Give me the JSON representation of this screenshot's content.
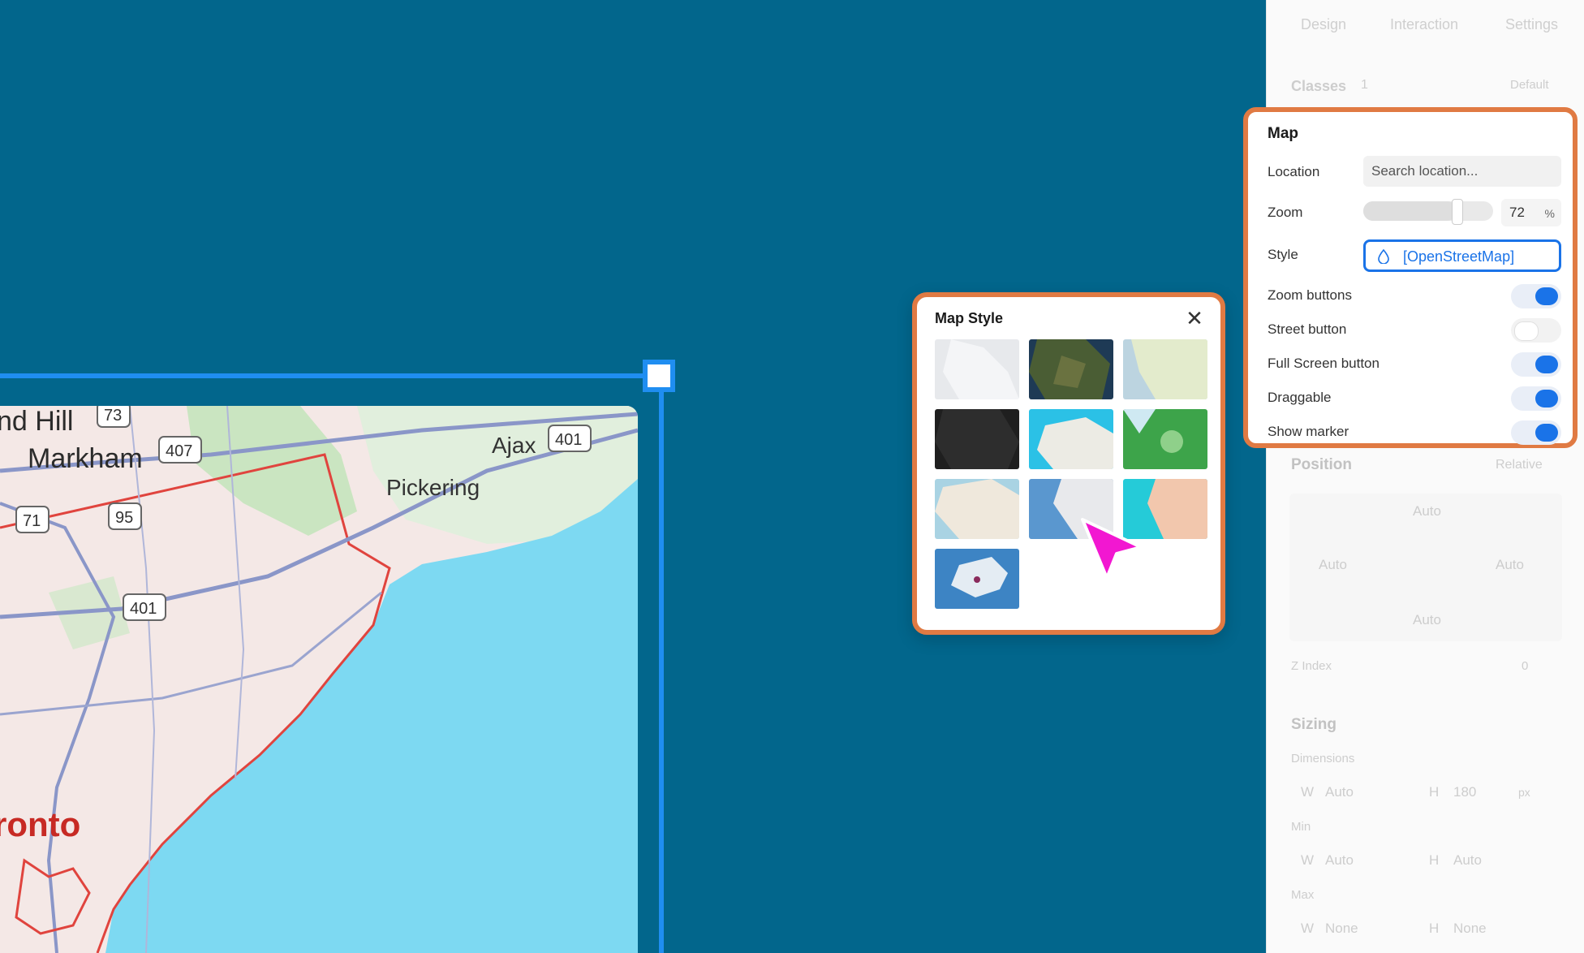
{
  "panel": {
    "tabs": [
      "Design",
      "Interaction",
      "Settings"
    ],
    "classes_label": "Classes",
    "classes_count": "1",
    "classes_default": "Default",
    "map_section": {
      "title": "Map",
      "location_label": "Location",
      "location_placeholder": "Search location...",
      "zoom_label": "Zoom",
      "zoom_value": "72",
      "zoom_percent": 72,
      "zoom_unit": "%",
      "style_label": "Style",
      "style_value": "[OpenStreetMap]",
      "toggles": [
        {
          "label": "Zoom buttons",
          "on": true
        },
        {
          "label": "Street button",
          "on": false
        },
        {
          "label": "Full Screen button",
          "on": true
        },
        {
          "label": "Draggable",
          "on": true
        },
        {
          "label": "Show marker",
          "on": true
        }
      ]
    },
    "position": {
      "title": "Position",
      "mode": "Relative",
      "top": "Auto",
      "left": "Auto",
      "right": "Auto",
      "bottom": "Auto",
      "zindex_label": "Z Index",
      "zindex_value": "0"
    },
    "sizing": {
      "title": "Sizing",
      "dimensions_label": "Dimensions",
      "w_prefix": "W",
      "h_prefix": "H",
      "w_value": "Auto",
      "h_value": "180",
      "h_unit": "px",
      "min_label": "Min",
      "min_w": "Auto",
      "min_h": "Auto",
      "max_label": "Max",
      "max_w": "None",
      "max_h": "None"
    }
  },
  "popover": {
    "title": "Map Style",
    "close": "✕",
    "tiles": [
      "light-gray",
      "satellite",
      "pastel",
      "dark",
      "cyan-relief",
      "green-terrain",
      "muted-road",
      "blue-water",
      "peach-water",
      "world-blue"
    ]
  },
  "map": {
    "labels": [
      "nd Hill",
      "Markham",
      "Pickering",
      "Ajax",
      "ronto"
    ],
    "shields": [
      "73",
      "407",
      "401",
      "71",
      "95",
      "401"
    ]
  },
  "colors": {
    "canvas_bg": "#02668c",
    "accent_blue": "#1a73e8",
    "highlight_orange": "#e07a43",
    "cursor_magenta": "#f217d1",
    "water": "#7dd9f2"
  }
}
